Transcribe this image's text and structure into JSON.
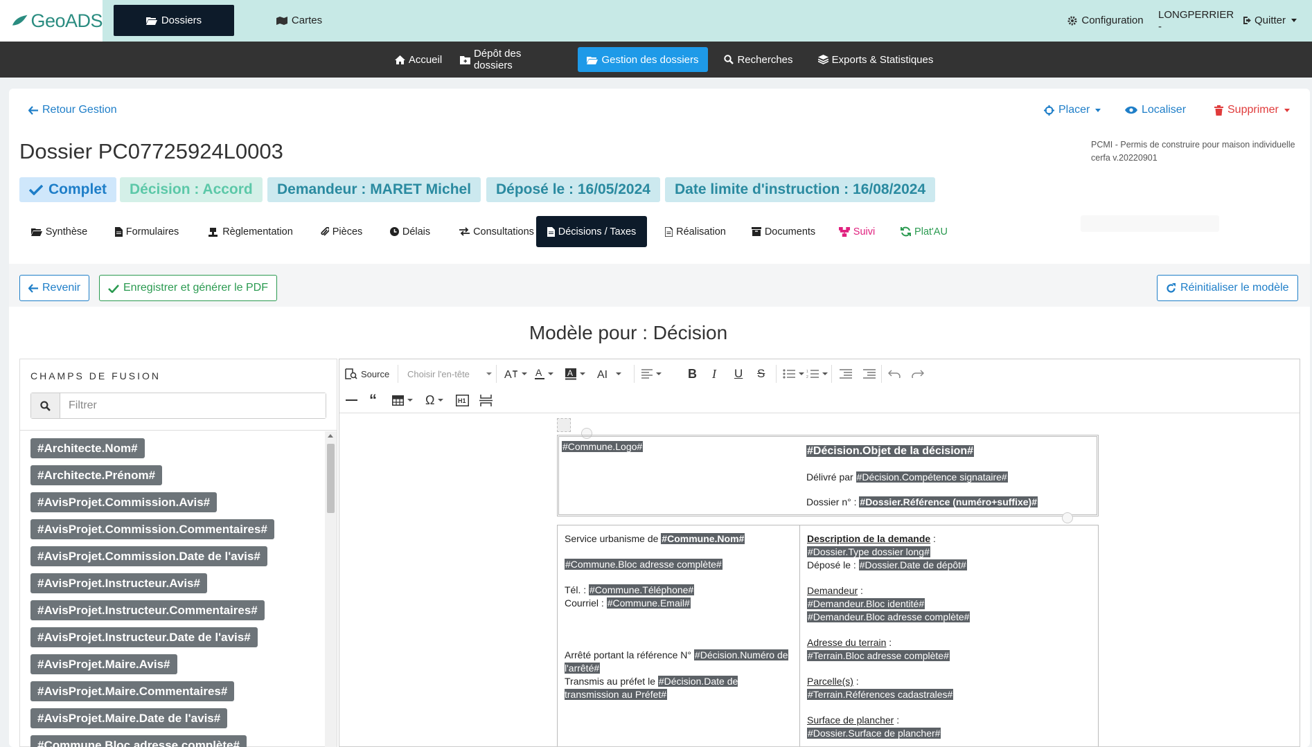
{
  "app": {
    "logo": "GeoADS"
  },
  "topnav": {
    "dossiers": "Dossiers",
    "cartes": "Cartes",
    "config": "Configuration",
    "user": "LONGPERRIER -",
    "quit": "Quitter"
  },
  "subnav": {
    "accueil": "Accueil",
    "depot": "Dépôt des dossiers",
    "gestion": "Gestion des dossiers",
    "recherches": "Recherches",
    "exports": "Exports & Statistiques"
  },
  "header": {
    "back": "Retour Gestion",
    "placer": "Placer",
    "localiser": "Localiser",
    "supprimer": "Supprimer",
    "title": "Dossier PC07725924L0003",
    "type_line1": "PCMI - Permis de construire pour maison individuelle",
    "type_line2": "cerfa v.20220901"
  },
  "badges": {
    "complet": "Complet",
    "decision": "Décision : Accord",
    "demandeur": "Demandeur : MARET Michel",
    "depose": "Déposé le : 16/05/2024",
    "limite": "Date limite d'instruction : 16/08/2024"
  },
  "tabs": {
    "synthese": "Synthèse",
    "formulaires": "Formulaires",
    "reglementation": "Règlementation",
    "pieces": "Pièces",
    "delais": "Délais",
    "consultations": "Consultations",
    "decisions": "Décisions / Taxes",
    "realisation": "Réalisation",
    "documents": "Documents",
    "suivi": "Suivi",
    "platau": "Plat'AU"
  },
  "actions": {
    "revenir": "Revenir",
    "save": "Enregistrer et générer le PDF",
    "reset": "Réinitialiser le modèle"
  },
  "model_title": "Modèle pour : Décision",
  "fusion": {
    "title": "CHAMPS DE FUSION",
    "filter_placeholder": "Filtrer",
    "tags": [
      "#Architecte.Nom#",
      "#Architecte.Prénom#",
      "#AvisProjet.Commission.Avis#",
      "#AvisProjet.Commission.Commentaires#",
      "#AvisProjet.Commission.Date de l'avis#",
      "#AvisProjet.Instructeur.Avis#",
      "#AvisProjet.Instructeur.Commentaires#",
      "#AvisProjet.Instructeur.Date de l'avis#",
      "#AvisProjet.Maire.Avis#",
      "#AvisProjet.Maire.Commentaires#",
      "#AvisProjet.Maire.Date de l'avis#",
      "#Commune.Bloc adresse complète#"
    ]
  },
  "editor": {
    "source": "Source",
    "heading_placeholder": "Choisir l'en-tête"
  },
  "doc": {
    "logo": "#Commune.Logo#",
    "objet": "#Décision.Objet de la décision#",
    "delivre_label": "Délivré par",
    "delivre_field": "#Décision.Compétence signataire#",
    "dossier_label": "Dossier n° :",
    "dossier_field": "#Dossier.Référence (numéro+suffixe)#",
    "service_label": "Service urbanisme de",
    "service_field": "#Commune.Nom#",
    "adresse_field": "#Commune.Bloc adresse complète#",
    "tel_label": "Tél. :",
    "tel_field": "#Commune.Téléphone#",
    "courriel_label": "Courriel :",
    "courriel_field": "#Commune.Email#",
    "arrete_label": "Arrêté portant la référence N°",
    "arrete_field": "#Décision.Numéro de l'arrêté#",
    "transmis_label": "Transmis au préfet le",
    "transmis_field": "#Décision.Date de transmission au Préfet#",
    "desc_label": "Description de la demande",
    "desc_suffix": " :",
    "type_field": "#Dossier.Type dossier long#",
    "depose_label": "Déposé le :",
    "depose_field": "#Dossier.Date de dépôt#",
    "demandeur_label": "Demandeur",
    "colon": " :",
    "dem_ident": "#Demandeur.Bloc identité#",
    "dem_adr": "#Demandeur.Bloc adresse complète#",
    "terrain_label": "Adresse du terrain",
    "terrain_field": "#Terrain.Bloc adresse complète#",
    "parcelle_label": "Parcelle(s)",
    "parcelle_field": "#Terrain.Références cadastrales#",
    "surface_label": "Surface de plancher",
    "surface_field": "#Dossier.Surface de plancher#"
  }
}
